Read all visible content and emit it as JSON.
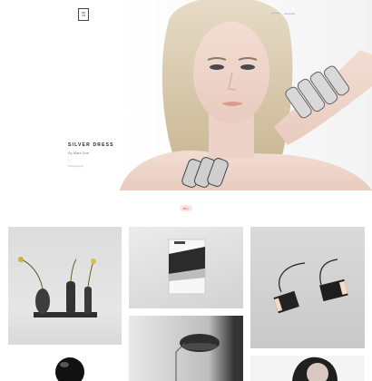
{
  "logo": {
    "lines": [
      "PR",
      "CN"
    ]
  },
  "nav": {
    "link": "Journal"
  },
  "hero": {
    "title": "SILVER DRESS",
    "subtitle": "By Mark Doe",
    "meta1": "—",
    "meta2": "Photography"
  },
  "filter": {
    "tag": "ALL"
  },
  "grid": {
    "items": [
      "Vases",
      "Book",
      "Lamp",
      "Floor lamp",
      "Sphere",
      "Portrait"
    ]
  },
  "colors": {
    "accent": "#c85a40",
    "tag_bg": "#fbe7e1"
  }
}
